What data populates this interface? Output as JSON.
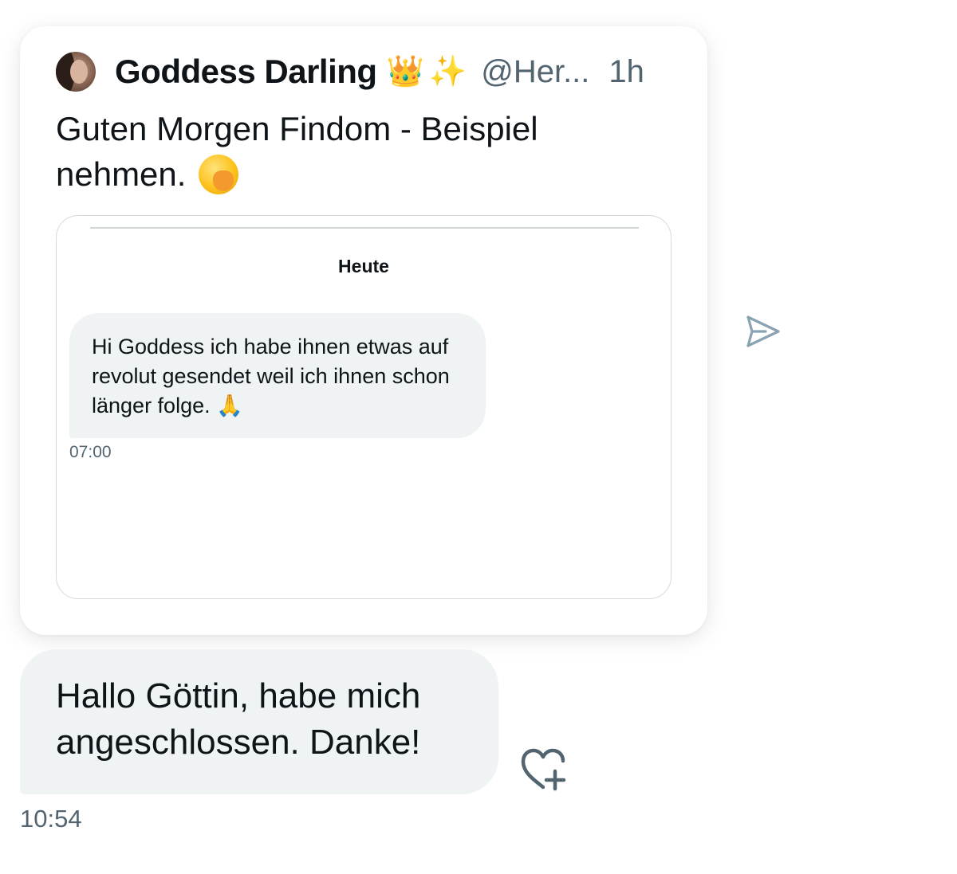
{
  "tweet": {
    "author_name": "Goddess Darling",
    "author_emoji_crown": "👑",
    "author_emoji_sparkles": "✨",
    "handle": "@Her...",
    "time_ago": "1h",
    "text_line1": "Guten Morgen Findom - Beispiel",
    "text_line2": "nehmen.",
    "text_emoji": "face-with-hand-over-mouth-emoji",
    "media": {
      "date_separator": "Heute",
      "message_text": "Hi Goddess ich habe ihnen etwas auf revolut gesendet weil ich ihnen schon länger folge. 🙏",
      "message_time": "07:00"
    }
  },
  "reply": {
    "text": "Hallo Göttin, habe mich angeschlossen. Danke!",
    "time": "10:54"
  },
  "icons": {
    "share": "share-send-icon",
    "reaction": "add-reaction-heart-icon"
  },
  "colors": {
    "bubble_bg": "#eff3f4",
    "secondary_text": "#536471",
    "icon_color": "#8aa3b3",
    "reaction_icon": "#536471"
  }
}
